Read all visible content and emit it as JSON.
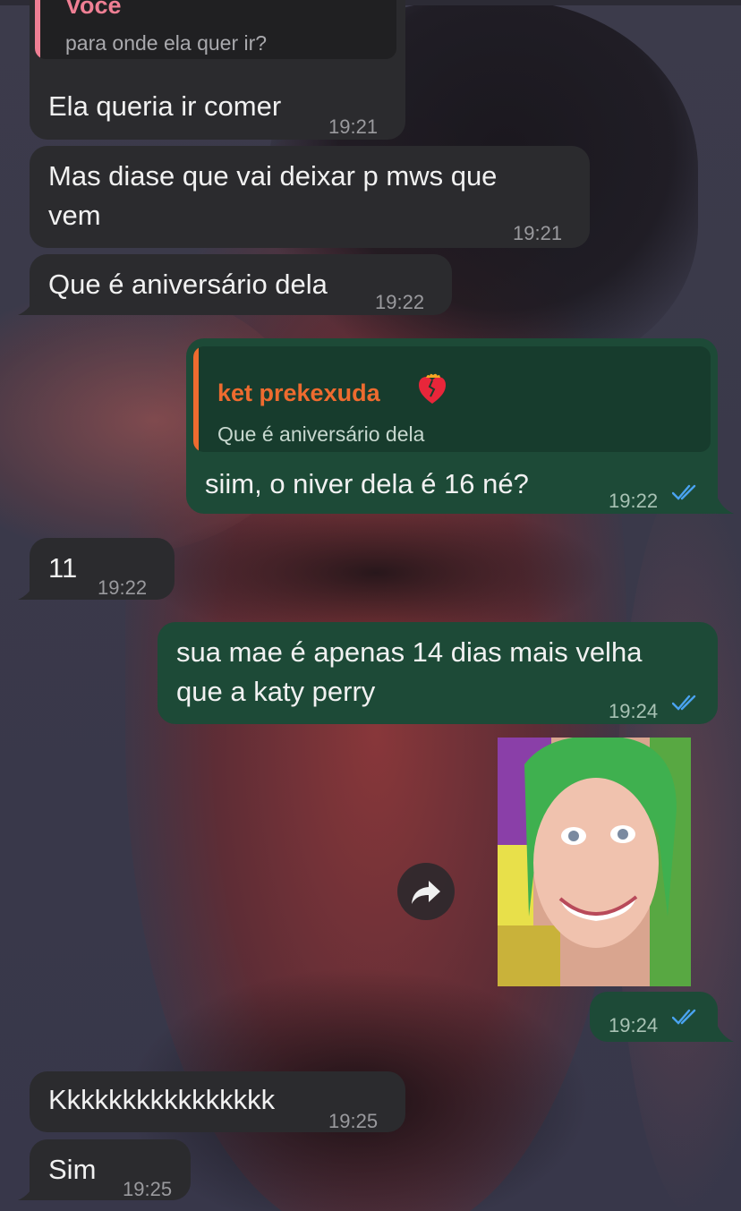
{
  "wallpaper": "photo-wallpaper",
  "colors": {
    "incoming": "#2b2b2e",
    "outgoing": "#1d4a37",
    "read_ticks": "#4aa3f0",
    "quote_orange": "#ee6b2f"
  },
  "messages": [
    {
      "quote_author": "Você",
      "quote_text": "para onde ela quer ir?",
      "text": "Ela queria ir comer",
      "time": "19:21"
    },
    {
      "text": "Mas diase que vai deixar p mws que\nvem",
      "time": "19:21"
    },
    {
      "text": "Que é aniversário dela",
      "time": "19:22"
    },
    {
      "quote_author": "ket prekexuda",
      "quote_text": "Que é aniversário dela",
      "text": "siim, o niver dela é 16 né?",
      "time": "19:22"
    },
    {
      "text": "11",
      "time": "19:22"
    },
    {
      "text": "sua mae é apenas 14 dias mais velha\nque a katy perry",
      "time": "19:24"
    },
    {
      "time": "19:24"
    },
    {
      "text": "Kkkkkkkkkkkkkkkk",
      "time": "19:25"
    },
    {
      "text": "Sim",
      "time": "19:25"
    }
  ]
}
